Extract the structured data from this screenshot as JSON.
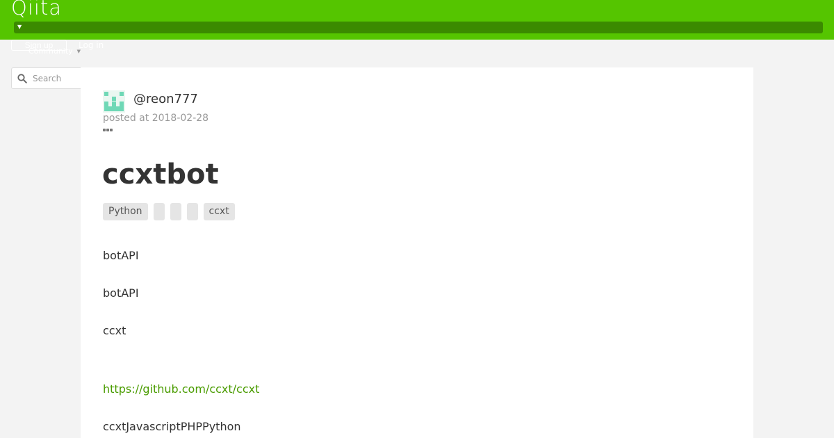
{
  "header": {
    "logo": "Qiita",
    "signup_label": "Sign up",
    "login_label": "Log in",
    "community_label": "Community"
  },
  "search": {
    "placeholder": "Search"
  },
  "article": {
    "author": "@reon777",
    "posted": "posted at 2018-02-28",
    "title": "ccxtbot",
    "tags": [
      "Python",
      "",
      "",
      "",
      "ccxt"
    ],
    "paragraphs": [
      "botAPI",
      "botAPI",
      "ccxt"
    ],
    "link": "https://github.com/ccxt/ccxt",
    "last_paragraph": "ccxtJavascriptPHPPython"
  },
  "colors": {
    "brand": "#55c500",
    "link": "#4a9c00"
  }
}
